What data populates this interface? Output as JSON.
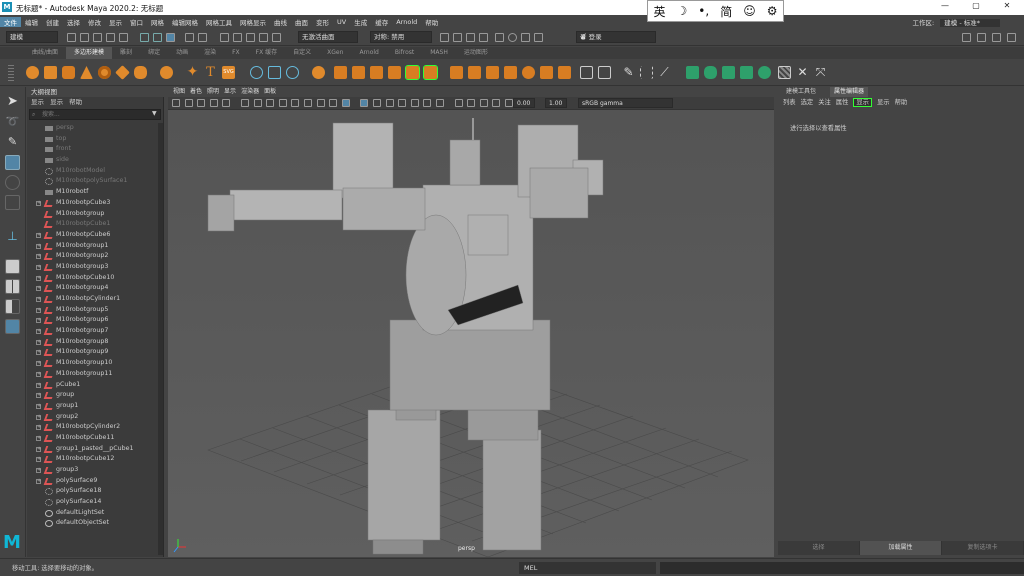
{
  "window": {
    "title": "无标题* - Autodesk Maya 2020.2: 无标题",
    "logo": "M"
  },
  "ime_bar": {
    "items": [
      "英",
      "☽",
      "•,",
      "简",
      "☺",
      "⚙"
    ]
  },
  "menubar": {
    "items": [
      "文件",
      "编辑",
      "创建",
      "选择",
      "修改",
      "显示",
      "窗口",
      "网格",
      "编辑网格",
      "网格工具",
      "网格显示",
      "曲线",
      "曲面",
      "变形",
      "UV",
      "生成",
      "缓存",
      "Arnold",
      "帮助"
    ],
    "workspace_label": "工作区:",
    "workspace_value": "建模 - 标准*"
  },
  "statusline": {
    "mode": "建模",
    "no_live_surface": "无激活曲面",
    "symmetry": "对称: 禁用",
    "login": "登录"
  },
  "shelf": {
    "tabs": [
      "曲线/曲面",
      "多边形建模",
      "雕刻",
      "绑定",
      "动画",
      "渲染",
      "FX",
      "FX 缓存",
      "自定义",
      "XGen",
      "Arnold",
      "Bifrost",
      "MASH",
      "运动图形"
    ],
    "active_tab": 1
  },
  "outliner": {
    "title": "大纲视图",
    "menu": [
      "显示",
      "显示",
      "帮助"
    ],
    "search_placeholder": "搜索...",
    "items": [
      {
        "label": "persp",
        "icon": "camera",
        "dim": true,
        "expand": false
      },
      {
        "label": "top",
        "icon": "camera",
        "dim": true,
        "expand": false
      },
      {
        "label": "front",
        "icon": "camera",
        "dim": true,
        "expand": false
      },
      {
        "label": "side",
        "icon": "camera",
        "dim": true,
        "expand": false
      },
      {
        "label": "M10robotModel",
        "icon": "node",
        "dim": true,
        "expand": false
      },
      {
        "label": "M10robotpolySurface1",
        "icon": "node",
        "dim": true,
        "expand": false
      },
      {
        "label": "M10robotf",
        "icon": "camera",
        "dim": false,
        "expand": false
      },
      {
        "label": "M10robotpCube3",
        "icon": "mesh",
        "dim": false,
        "expand": true
      },
      {
        "label": "M10robotgroup",
        "icon": "mesh",
        "dim": false,
        "expand": false
      },
      {
        "label": "M10robotpCube1",
        "icon": "mesh",
        "dim": true,
        "expand": false
      },
      {
        "label": "M10robotpCube6",
        "icon": "mesh",
        "dim": false,
        "expand": true
      },
      {
        "label": "M10robotgroup1",
        "icon": "mesh",
        "dim": false,
        "expand": true
      },
      {
        "label": "M10robotgroup2",
        "icon": "mesh",
        "dim": false,
        "expand": true
      },
      {
        "label": "M10robotgroup3",
        "icon": "mesh",
        "dim": false,
        "expand": true
      },
      {
        "label": "M10robotpCube10",
        "icon": "mesh",
        "dim": false,
        "expand": true
      },
      {
        "label": "M10robotgroup4",
        "icon": "mesh",
        "dim": false,
        "expand": true
      },
      {
        "label": "M10robotpCylinder1",
        "icon": "mesh",
        "dim": false,
        "expand": true
      },
      {
        "label": "M10robotgroup5",
        "icon": "mesh",
        "dim": false,
        "expand": true
      },
      {
        "label": "M10robotgroup6",
        "icon": "mesh",
        "dim": false,
        "expand": true
      },
      {
        "label": "M10robotgroup7",
        "icon": "mesh",
        "dim": false,
        "expand": true
      },
      {
        "label": "M10robotgroup8",
        "icon": "mesh",
        "dim": false,
        "expand": true
      },
      {
        "label": "M10robotgroup9",
        "icon": "mesh",
        "dim": false,
        "expand": true
      },
      {
        "label": "M10robotgroup10",
        "icon": "mesh",
        "dim": false,
        "expand": true
      },
      {
        "label": "M10robotgroup11",
        "icon": "mesh",
        "dim": false,
        "expand": true
      },
      {
        "label": "pCube1",
        "icon": "mesh",
        "dim": false,
        "expand": true
      },
      {
        "label": "group",
        "icon": "mesh",
        "dim": false,
        "expand": true
      },
      {
        "label": "group1",
        "icon": "mesh",
        "dim": false,
        "expand": true
      },
      {
        "label": "group2",
        "icon": "mesh",
        "dim": false,
        "expand": true
      },
      {
        "label": "M10robotpCylinder2",
        "icon": "mesh",
        "dim": false,
        "expand": true
      },
      {
        "label": "M10robotpCube11",
        "icon": "mesh",
        "dim": false,
        "expand": true
      },
      {
        "label": "group1_pasted__pCube1",
        "icon": "mesh",
        "dim": false,
        "expand": true
      },
      {
        "label": "M10robotpCube12",
        "icon": "mesh",
        "dim": false,
        "expand": true
      },
      {
        "label": "group3",
        "icon": "mesh",
        "dim": false,
        "expand": true
      },
      {
        "label": "polySurface9",
        "icon": "mesh",
        "dim": false,
        "expand": true
      },
      {
        "label": "polySurface18",
        "icon": "node",
        "dim": false,
        "expand": false
      },
      {
        "label": "polySurface14",
        "icon": "node",
        "dim": false,
        "expand": false
      },
      {
        "label": "defaultLightSet",
        "icon": "set",
        "dim": false,
        "expand": false
      },
      {
        "label": "defaultObjectSet",
        "icon": "set",
        "dim": false,
        "expand": false
      }
    ]
  },
  "viewport": {
    "menu": [
      "视图",
      "着色",
      "照明",
      "显示",
      "渲染器",
      "面板"
    ],
    "exposure": "0.00",
    "gamma": "1.00",
    "color_space": "sRGB gamma",
    "camera_label": "persp"
  },
  "attribute_editor": {
    "tabs": [
      "建模工具包",
      "属性编辑器"
    ],
    "menu": [
      "列表",
      "选定",
      "关注",
      "属性",
      "显示",
      "显示",
      "帮助"
    ],
    "highlight_index": 4,
    "message": "进行选择以查看属性",
    "footer": [
      "选择",
      "加载属性",
      "复制选项卡"
    ]
  },
  "helpline": {
    "message": "移动工具: 选择要移动的对象。",
    "mel_label": "MEL"
  },
  "colors": {
    "accent": "#5285a6",
    "highlight": "#33ff33",
    "viewport_bg": "#5a5a5a"
  }
}
